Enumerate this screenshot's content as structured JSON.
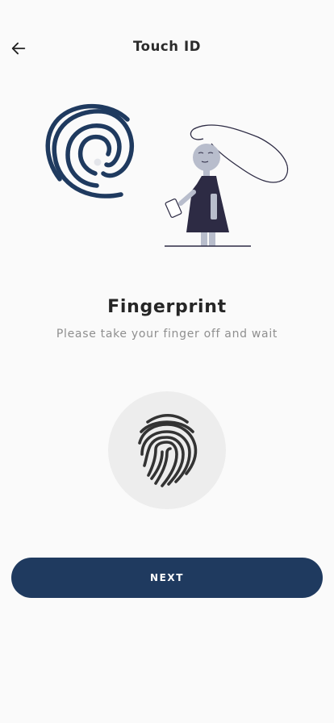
{
  "header": {
    "title": "Touch ID",
    "back_icon": "arrow-left-icon"
  },
  "illustration": {
    "fingerprint_icon": "fingerprint-spiral-icon",
    "person": "woman-holding-phone-illustration"
  },
  "main": {
    "title": "Fingerprint",
    "subtitle": "Please take your finger off and wait",
    "scanner_icon": "fingerprint-icon"
  },
  "actions": {
    "next_label": "NEXT"
  },
  "colors": {
    "primary": "#1f3a5f",
    "background": "#fafafa",
    "scanner_bg": "#ededed",
    "figure_dark": "#2d2b44",
    "figure_skin": "#b8bdcc"
  }
}
